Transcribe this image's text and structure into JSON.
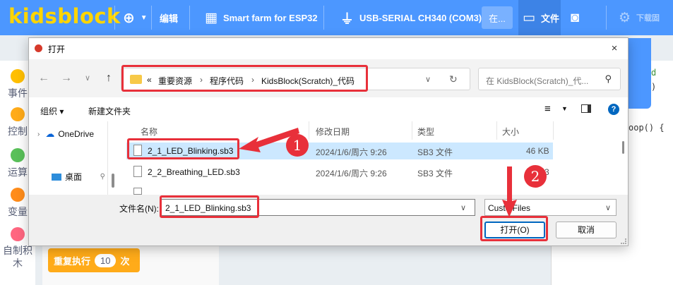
{
  "app": {
    "logo": "kidsblock",
    "edit_label": "编辑",
    "device_label": "Smart farm for ESP32",
    "port_label": "USB-SERIAL CH340 (COM3)",
    "online_label": "在...",
    "file_label": "文件",
    "download_label": "下载固"
  },
  "background": {
    "categories": [
      "事件",
      "控制",
      "运算",
      "变量",
      "自制积木"
    ],
    "category_colors": [
      "#ffbf00",
      "#ffab19",
      "#59c059",
      "#ff8c1a",
      "#ff6680"
    ],
    "repeat_block_label": "重复执行",
    "repeat_count": "10",
    "repeat_unit": "次",
    "code_snippets": [
      "d",
      ")",
      "oop() {"
    ]
  },
  "dialog": {
    "title": "打开",
    "close_icon": "×",
    "breadcrumb_prefix": "«",
    "breadcrumbs": [
      "重要资源",
      "程序代码",
      "KidsBlock(Scratch)_代码"
    ],
    "search_placeholder": "在 KidsBlock(Scratch)_代...",
    "organize_label": "组织 ▾",
    "new_folder_label": "新建文件夹",
    "sidebar": [
      {
        "label": "OneDrive"
      },
      {
        "label": "桌面"
      }
    ],
    "columns": [
      "名称",
      "修改日期",
      "类型",
      "大小"
    ],
    "files": [
      {
        "name": "2_1_LED_Blinking.sb3",
        "date": "2024/1/6/周六 9:26",
        "type": "SB3 文件",
        "size": "46 KB",
        "selected": true
      },
      {
        "name": "2_2_Breathing_LED.sb3",
        "date": "2024/1/6/周六 9:26",
        "type": "SB3 文件",
        "size": "3",
        "selected": false
      }
    ],
    "filename_label": "文件名(N):",
    "filename_value": "2_1_LED_Blinking.sb3",
    "filetype_value": "Custo   Files",
    "open_button": "打开(O)",
    "cancel_button": "取消"
  },
  "annotations": {
    "badge1": "1",
    "badge2": "2",
    "color": "#e8303a"
  }
}
